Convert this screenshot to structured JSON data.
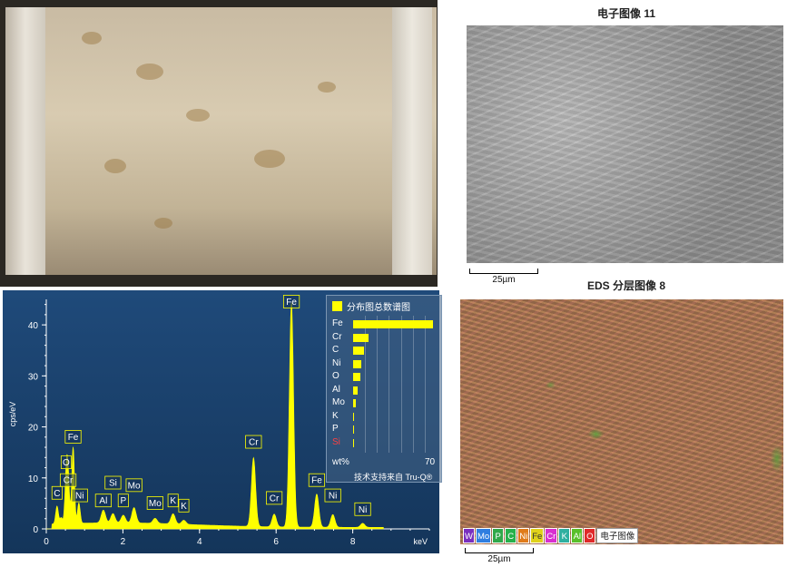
{
  "sem_panel": {
    "title": "电子图像 11",
    "scale_label": "25µm"
  },
  "map_panel": {
    "title": "EDS 分层图像 8",
    "scale_label": "25µm",
    "element_chips": [
      {
        "symbol": "W",
        "color": "#7a2fbf"
      },
      {
        "symbol": "Mo",
        "color": "#2f7ee0"
      },
      {
        "symbol": "P",
        "color": "#2fa84a"
      },
      {
        "symbol": "C",
        "color": "#27b04b"
      },
      {
        "symbol": "Ni",
        "color": "#e07b1a"
      },
      {
        "symbol": "Fe",
        "color": "#e0d21a"
      },
      {
        "symbol": "Cr",
        "color": "#d82fd0"
      },
      {
        "symbol": "K",
        "color": "#2fb0a0"
      },
      {
        "symbol": "Al",
        "color": "#58c02a"
      },
      {
        "symbol": "O",
        "color": "#e02a2a"
      }
    ],
    "base_label": "电子图像"
  },
  "spectrum": {
    "colors": {
      "accent": "#ffff00",
      "panel": "#1b4270",
      "label_error": "#ff4040"
    },
    "legend_title": "分布图总数谱图",
    "legend_unit": "wt%",
    "legend_max": "70",
    "legend_credit": "技术支持来自 Tru-Q®",
    "legend_rows": [
      {
        "el": "Fe",
        "wt": 67,
        "error": false
      },
      {
        "el": "Cr",
        "wt": 13,
        "error": false
      },
      {
        "el": "C",
        "wt": 9,
        "error": false
      },
      {
        "el": "Ni",
        "wt": 7,
        "error": false
      },
      {
        "el": "O",
        "wt": 6,
        "error": false
      },
      {
        "el": "Al",
        "wt": 4,
        "error": false
      },
      {
        "el": "Mo",
        "wt": 2,
        "error": false
      },
      {
        "el": "K",
        "wt": 0.5,
        "error": false
      },
      {
        "el": "P",
        "wt": 0.5,
        "error": false
      },
      {
        "el": "Si",
        "wt": 0,
        "error": true
      }
    ]
  },
  "chart_data": {
    "type": "line",
    "xlabel": "keV",
    "ylabel": "cps/eV",
    "xlim": [
      0,
      10
    ],
    "ylim": [
      0,
      45
    ],
    "x_ticks": [
      "0",
      "2",
      "4",
      "6",
      "8"
    ],
    "y_ticks": [
      "0",
      "10",
      "20",
      "30",
      "40"
    ],
    "grid": false,
    "peaks": [
      {
        "x": 0.28,
        "y": 3.5
      },
      {
        "x": 0.39,
        "y": 1.2
      },
      {
        "x": 0.52,
        "y": 9.0
      },
      {
        "x": 0.57,
        "y": 8.5
      },
      {
        "x": 0.7,
        "y": 15.0
      },
      {
        "x": 0.85,
        "y": 4.0
      },
      {
        "x": 1.49,
        "y": 2.5
      },
      {
        "x": 1.74,
        "y": 1.8
      },
      {
        "x": 2.01,
        "y": 1.5
      },
      {
        "x": 2.29,
        "y": 3.0
      },
      {
        "x": 2.84,
        "y": 1.0
      },
      {
        "x": 3.31,
        "y": 2.0
      },
      {
        "x": 3.59,
        "y": 0.8
      },
      {
        "x": 5.41,
        "y": 13.5
      },
      {
        "x": 5.95,
        "y": 2.5
      },
      {
        "x": 6.4,
        "y": 44.0
      },
      {
        "x": 7.06,
        "y": 6.5
      },
      {
        "x": 7.48,
        "y": 2.5
      },
      {
        "x": 8.26,
        "y": 0.8
      }
    ],
    "peak_labels": [
      {
        "text": "C",
        "x": 0.28,
        "y": 6.0
      },
      {
        "text": "O",
        "x": 0.52,
        "y": 12.0
      },
      {
        "text": "Cr",
        "x": 0.57,
        "y": 8.5
      },
      {
        "text": "Fe",
        "x": 0.7,
        "y": 17.0
      },
      {
        "text": "Ni",
        "x": 0.87,
        "y": 5.5
      },
      {
        "text": "Al",
        "x": 1.49,
        "y": 4.5
      },
      {
        "text": "Si",
        "x": 1.74,
        "y": 8.0
      },
      {
        "text": "P",
        "x": 2.01,
        "y": 4.5
      },
      {
        "text": "Mo",
        "x": 2.29,
        "y": 7.5
      },
      {
        "text": "Mo",
        "x": 2.84,
        "y": 4.0
      },
      {
        "text": "K",
        "x": 3.31,
        "y": 4.5
      },
      {
        "text": "K",
        "x": 3.59,
        "y": 3.5
      },
      {
        "text": "Cr",
        "x": 5.41,
        "y": 16.0
      },
      {
        "text": "Cr",
        "x": 5.95,
        "y": 5.0
      },
      {
        "text": "Fe",
        "x": 6.4,
        "y": 43.5
      },
      {
        "text": "Fe",
        "x": 7.06,
        "y": 8.5
      },
      {
        "text": "Ni",
        "x": 7.48,
        "y": 5.5
      },
      {
        "text": "Ni",
        "x": 8.26,
        "y": 2.8
      }
    ]
  }
}
